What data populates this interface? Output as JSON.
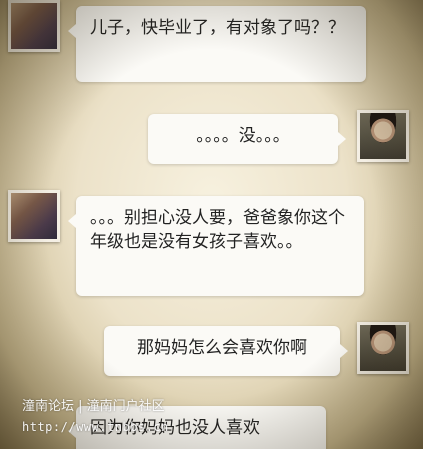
{
  "messages": [
    {
      "side": "left",
      "text": "儿子，快毕业了，有对象了吗？？"
    },
    {
      "side": "right",
      "text": "。。。。没。。。"
    },
    {
      "side": "left",
      "text": "。。。别担心没人要，爸爸象你这个年级也是没有女孩子喜欢。。"
    },
    {
      "side": "right",
      "text": "那妈妈怎么会喜欢你啊"
    },
    {
      "side": "left",
      "text": "因为你妈妈也没人喜欢"
    }
  ],
  "watermark": {
    "line1": "潼南论坛 | 潼南门户社区",
    "line2": "http://www.tnbbs.cn"
  }
}
